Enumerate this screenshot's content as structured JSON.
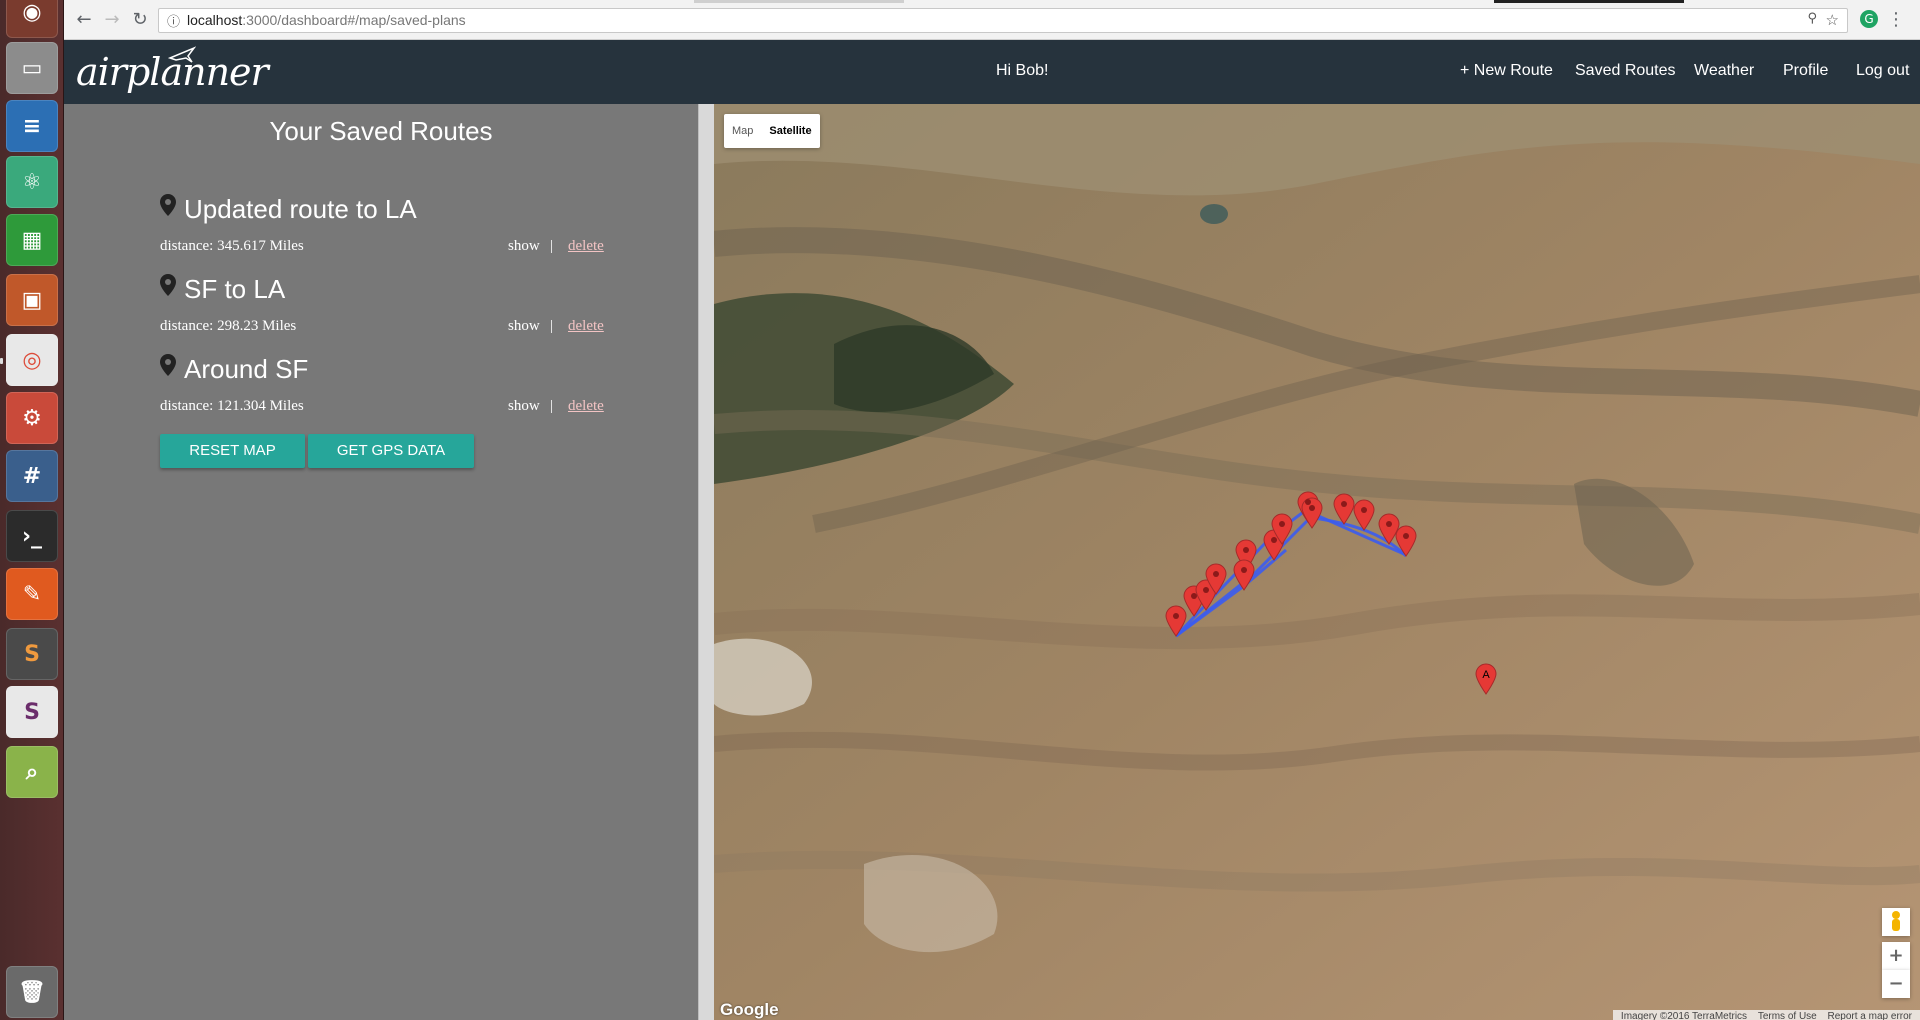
{
  "browser": {
    "url_host": "localhost",
    "url_path": ":3000/dashboard#/map/saved-plans"
  },
  "header": {
    "logo": "airplanner",
    "greeting": "Hi Bob!",
    "nav": [
      "+ New Route",
      "Saved Routes",
      "Weather",
      "Profile",
      "Log out"
    ]
  },
  "panel": {
    "title": "Your Saved Routes",
    "routes": [
      {
        "name": "Updated route to LA",
        "distance": "distance: 345.617 Miles",
        "show": "show",
        "sep": "|",
        "delete": "delete"
      },
      {
        "name": "SF to LA",
        "distance": "distance: 298.23 Miles",
        "show": "show",
        "sep": "|",
        "delete": "delete"
      },
      {
        "name": "Around SF",
        "distance": "distance: 121.304 Miles",
        "show": "show",
        "sep": "|",
        "delete": "delete"
      }
    ],
    "reset_button": "RESET MAP",
    "gps_button": "GET GPS DATA"
  },
  "map": {
    "type_map": "Map",
    "type_satellite": "Satellite",
    "marker_a_label": "A",
    "zoom_in": "+",
    "zoom_out": "−",
    "google": "Google",
    "imagery": "Imagery ©2016 TerraMetrics",
    "terms": "Terms of Use",
    "report": "Report a map error"
  },
  "colors": {
    "header_bg": "#26333d",
    "panel_bg": "#787878",
    "button_bg": "#26a69a",
    "route_line": "#3b5cf0",
    "marker": "#e53935"
  }
}
